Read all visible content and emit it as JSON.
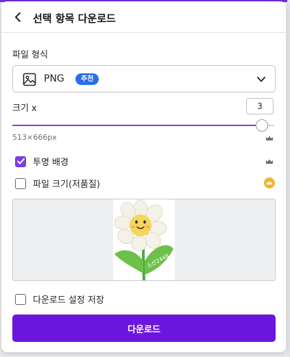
{
  "header": {
    "title": "선택 항목 다운로드",
    "back_icon": "chevron-left-icon"
  },
  "file_type": {
    "label": "파일 형식",
    "selected": "PNG",
    "badge": "추천",
    "icon": "image-icon",
    "dropdown_icon": "chevron-down-icon"
  },
  "size": {
    "label": "크기 x",
    "value": "3",
    "slider_fraction": 0.95,
    "dimensions": "513×666px"
  },
  "options": {
    "transparent_bg": {
      "label": "투명 배경",
      "checked": true
    },
    "compress": {
      "label": "파일 크기(저품질)",
      "checked": false
    }
  },
  "preview": {
    "image_text": "소산2448"
  },
  "save_settings": {
    "label": "다운로드 설정 저장",
    "checked": false
  },
  "download_button": {
    "label": "다운로드"
  },
  "colors": {
    "accent": "#7b3fe4",
    "button": "#6b16dc",
    "badge": "#2a6ee8",
    "premium": "#f0b530"
  }
}
